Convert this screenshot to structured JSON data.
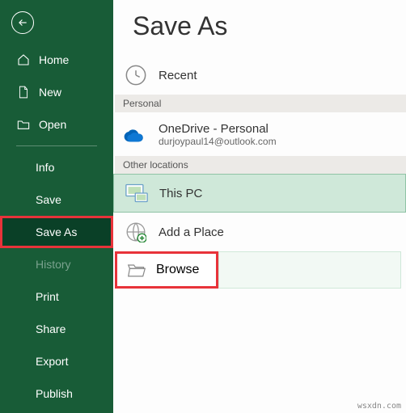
{
  "sidebar": {
    "home": "Home",
    "new": "New",
    "open": "Open",
    "info": "Info",
    "save": "Save",
    "save_as": "Save As",
    "history": "History",
    "print": "Print",
    "share": "Share",
    "export": "Export",
    "publish": "Publish"
  },
  "main": {
    "title": "Save As",
    "recent": "Recent",
    "section_personal": "Personal",
    "onedrive_title": "OneDrive - Personal",
    "onedrive_sub": "durjoypaul14@outlook.com",
    "section_other": "Other locations",
    "this_pc": "This PC",
    "add_place": "Add a Place",
    "browse": "Browse"
  },
  "watermark": "wsxdn.com"
}
